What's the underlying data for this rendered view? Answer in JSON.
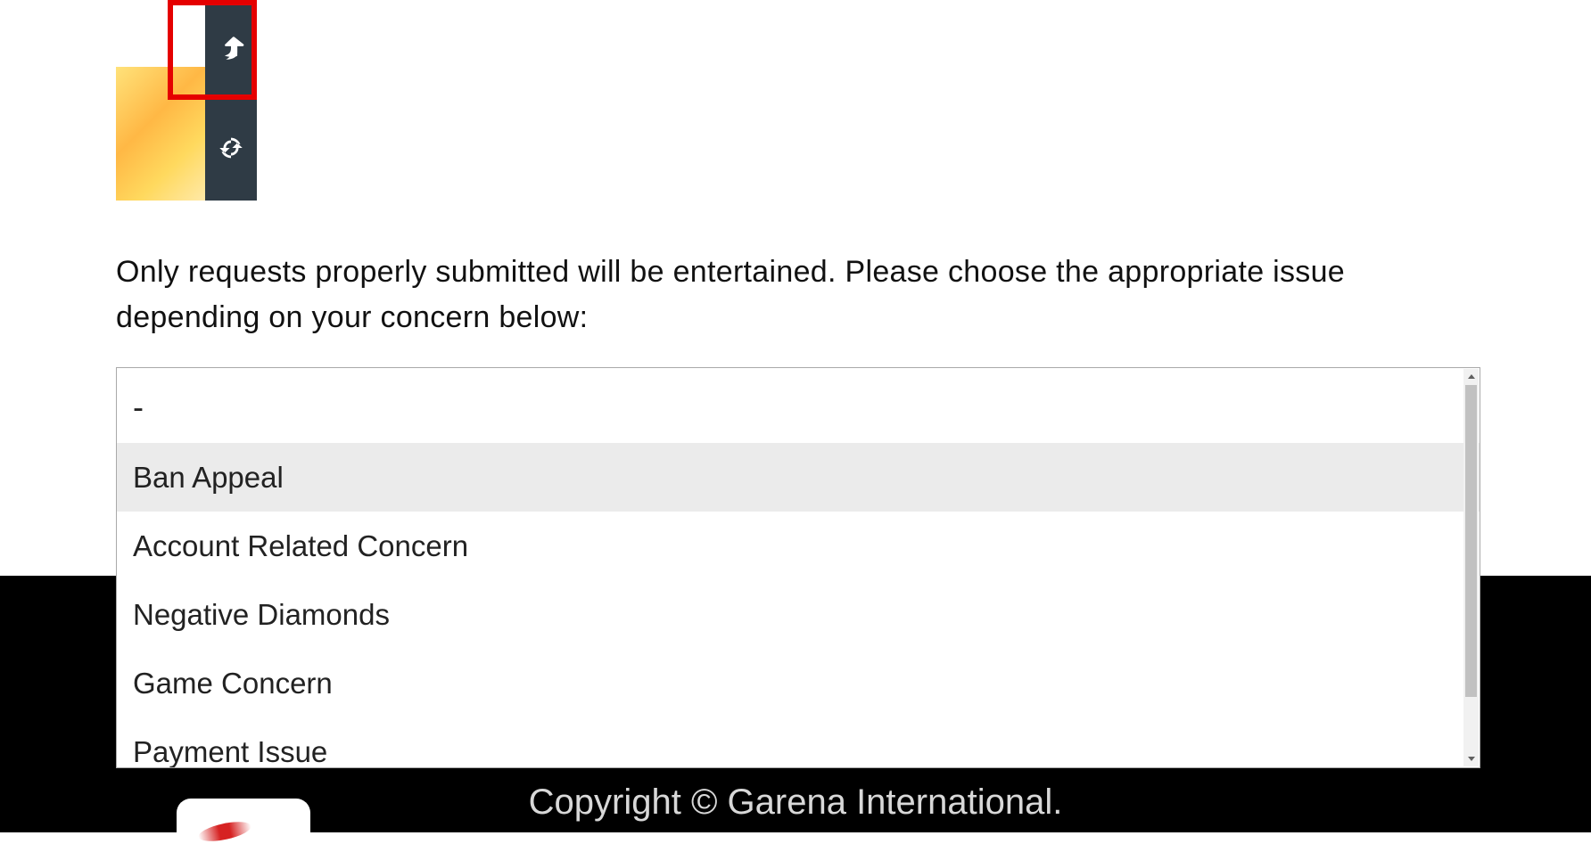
{
  "instruction_text": "Only requests properly submitted will be entertained. Please choose the appropriate issue depending on your concern below:",
  "dropdown": {
    "options": [
      "-",
      "Ban Appeal",
      "Account Related Concern",
      "Negative Diamonds",
      "Game Concern",
      "Payment Issue"
    ],
    "highlighted_index": 1
  },
  "footer": {
    "copyright": "Copyright © Garena International."
  },
  "toolbar": {
    "share_icon": "share-arrow",
    "refresh_icon": "refresh"
  }
}
